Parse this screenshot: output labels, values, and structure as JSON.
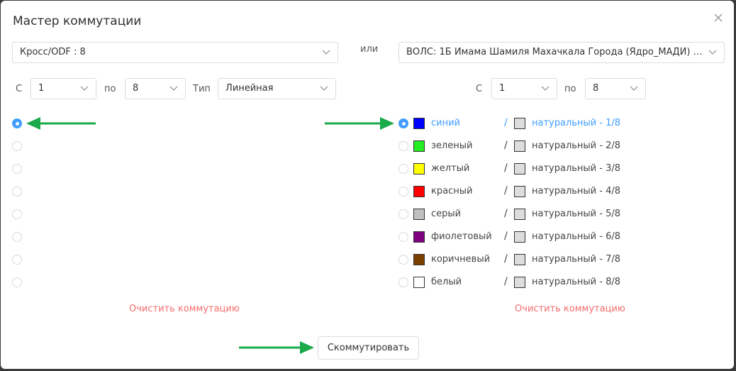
{
  "dialog": {
    "title": "Мастер коммутации",
    "or_label": "или"
  },
  "left": {
    "device_select": "Кросс/ODF : 8",
    "from_label": "С",
    "from_value": "1",
    "to_label": "по",
    "to_value": "8",
    "type_label": "Тип",
    "type_value": "Линейная",
    "ports": [
      {
        "selected": true
      },
      {
        "selected": false
      },
      {
        "selected": false
      },
      {
        "selected": false
      },
      {
        "selected": false
      },
      {
        "selected": false
      },
      {
        "selected": false
      },
      {
        "selected": false
      }
    ],
    "clear_label": "Очистить коммутацию"
  },
  "right": {
    "cable_select": "ВОЛС: 1Б Имама Шамиля Махачкала Города (Ядро_МАДИ) #...",
    "from_label": "С",
    "from_value": "1",
    "to_label": "по",
    "to_value": "8",
    "fibers": [
      {
        "name": "синий",
        "color": "#0000ff",
        "module_color": "#dddddd",
        "module": "натуральный - 1/8",
        "selected": true
      },
      {
        "name": "зеленый",
        "color": "#22ee22",
        "module_color": "#dddddd",
        "module": "натуральный - 2/8",
        "selected": false
      },
      {
        "name": "желтый",
        "color": "#ffff00",
        "module_color": "#dddddd",
        "module": "натуральный - 3/8",
        "selected": false
      },
      {
        "name": "красный",
        "color": "#ff0000",
        "module_color": "#dddddd",
        "module": "натуральный - 4/8",
        "selected": false
      },
      {
        "name": "серый",
        "color": "#c0c0c0",
        "module_color": "#dddddd",
        "module": "натуральный - 5/8",
        "selected": false
      },
      {
        "name": "фиолетовый",
        "color": "#800080",
        "module_color": "#dddddd",
        "module": "натуральный - 6/8",
        "selected": false
      },
      {
        "name": "коричневый",
        "color": "#7b3f00",
        "module_color": "#dddddd",
        "module": "натуральный - 7/8",
        "selected": false
      },
      {
        "name": "белый",
        "color": "#ffffff",
        "module_color": "#dddddd",
        "module": "натуральный - 8/8",
        "selected": false
      }
    ],
    "clear_label": "Очистить коммутацию"
  },
  "actions": {
    "commit_label": "Скоммутировать"
  },
  "colors": {
    "accent": "#409eff",
    "danger": "#f56c6c",
    "annotation_arrow": "#1aaa4a"
  }
}
